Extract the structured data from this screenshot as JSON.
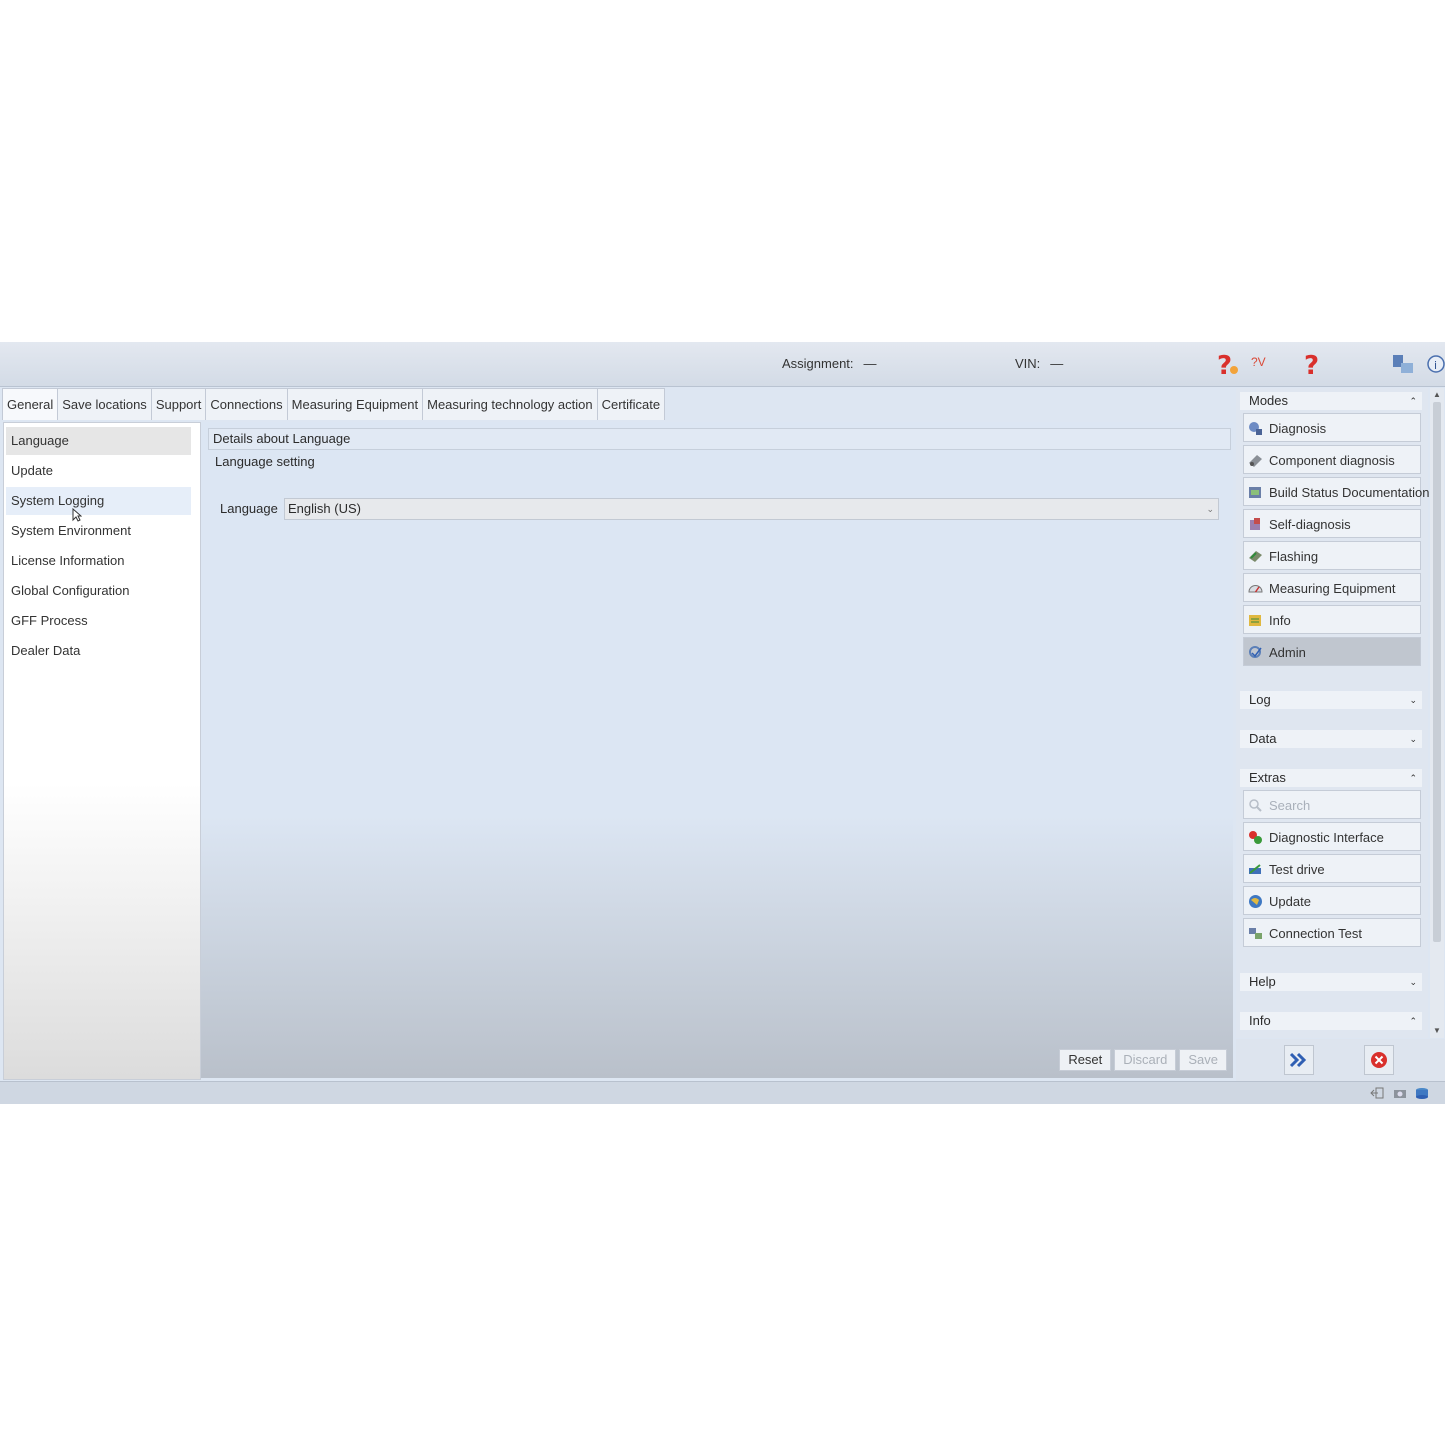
{
  "header": {
    "assignment_label": "Assignment:",
    "assignment_value": "—",
    "vin_label": "VIN:",
    "vin_value": "—",
    "help_text": "?V"
  },
  "tabs": [
    {
      "label": "General"
    },
    {
      "label": "Save locations"
    },
    {
      "label": "Support"
    },
    {
      "label": "Connections"
    },
    {
      "label": "Measuring Equipment"
    },
    {
      "label": "Measuring technology action"
    },
    {
      "label": "Certificate"
    }
  ],
  "nav": [
    {
      "label": "Language"
    },
    {
      "label": "Update"
    },
    {
      "label": "System Logging"
    },
    {
      "label": "System Environment"
    },
    {
      "label": "License Information"
    },
    {
      "label": "Global Configuration"
    },
    {
      "label": "GFF Process"
    },
    {
      "label": "Dealer Data"
    }
  ],
  "content": {
    "details_title": "Details about Language",
    "section": "Language setting",
    "language_label": "Language",
    "language_value": "English (US)",
    "reset": "Reset",
    "discard": "Discard",
    "save": "Save"
  },
  "right_panel": {
    "modes_title": "Modes",
    "modes": [
      {
        "label": "Diagnosis",
        "icon": "diagnosis-icon"
      },
      {
        "label": "Component diagnosis",
        "icon": "component-icon"
      },
      {
        "label": "Build Status Documentation",
        "icon": "build-status-icon"
      },
      {
        "label": "Self-diagnosis",
        "icon": "self-diagnosis-icon"
      },
      {
        "label": "Flashing",
        "icon": "flashing-icon"
      },
      {
        "label": "Measuring Equipment",
        "icon": "measuring-icon"
      },
      {
        "label": "Info",
        "icon": "info-icon"
      },
      {
        "label": "Admin",
        "icon": "admin-icon"
      }
    ],
    "log_title": "Log",
    "data_title": "Data",
    "extras_title": "Extras",
    "extras": [
      {
        "label": "Search",
        "icon": "search-icon"
      },
      {
        "label": "Diagnostic Interface",
        "icon": "interface-icon"
      },
      {
        "label": "Test drive",
        "icon": "test-drive-icon"
      },
      {
        "label": "Update",
        "icon": "update-icon"
      },
      {
        "label": "Connection Test",
        "icon": "connection-icon"
      }
    ],
    "help_title": "Help",
    "info_title": "Info"
  },
  "colors": {
    "accent_red": "#d9302c",
    "active_mode": "#c0c6cf",
    "forward_blue": "#2f5fb3"
  }
}
